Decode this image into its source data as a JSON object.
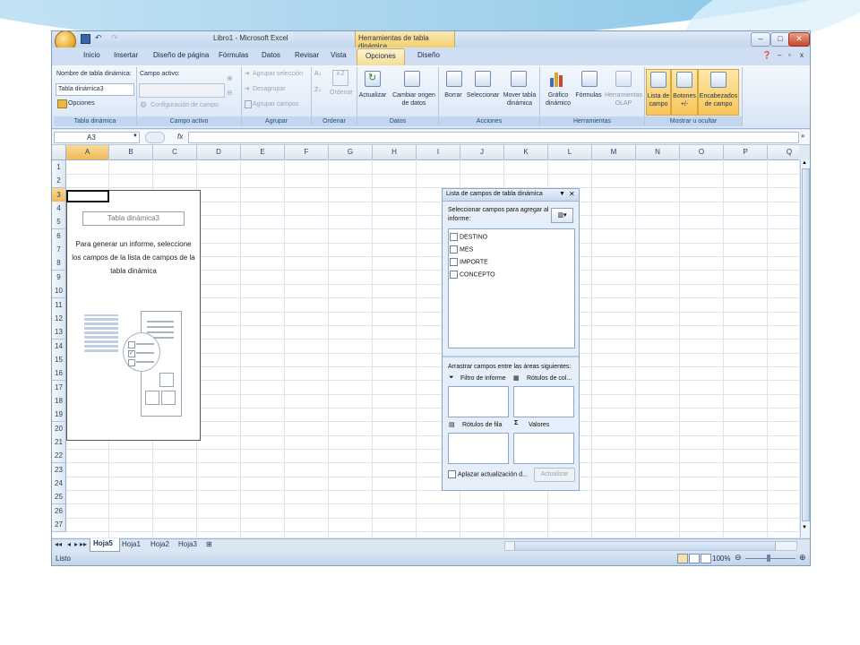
{
  "window": {
    "title": "Libro1 - Microsoft Excel",
    "context_tab": "Herramientas de tabla dinámica",
    "controls": [
      "–",
      "□",
      "✕"
    ]
  },
  "tabs": [
    "Inicio",
    "Insertar",
    "Diseño de página",
    "Fórmulas",
    "Datos",
    "Revisar",
    "Vista",
    "Opciones",
    "Diseño"
  ],
  "active_tab": "Opciones",
  "ribbon": {
    "tabla_dinamica": {
      "name_label": "Nombre de tabla dinámica:",
      "name_value": "Tabla dinámica3",
      "opciones": "Opciones",
      "group": "Tabla dinámica"
    },
    "campo_activo": {
      "label": "Campo activo:",
      "config": "Configuración de campo",
      "group": "Campo activo"
    },
    "agrupar": {
      "items": [
        "Agrupar selección",
        "Desagrupar",
        "Agrupar campos"
      ],
      "group": "Agrupar"
    },
    "ordenar": {
      "label": "Ordenar",
      "group": "Ordenar"
    },
    "datos": {
      "actualizar": "Actualizar",
      "cambiar_origen": "Cambiar origen",
      "cambiar_origen_2": "de datos",
      "group": "Datos"
    },
    "acciones": {
      "borrar": "Borrar",
      "seleccionar": "Seleccionar",
      "mover": "Mover tabla",
      "mover_2": "dinámica",
      "group": "Acciones"
    },
    "herramientas": {
      "grafico": "Gráfico",
      "grafico_2": "dinámico",
      "formulas": "Fórmulas",
      "olap": "Herramientas",
      "olap_2": "OLAP",
      "group": "Herramientas"
    },
    "mostrar": {
      "lista": "Lista de",
      "lista_2": "campo",
      "botones": "Botones",
      "botones_2": "+/-",
      "encabezados": "Encabezados",
      "encabezados_2": "de campo",
      "group": "Mostrar u ocultar"
    }
  },
  "formula_bar": {
    "name_box": "A3",
    "fx": "fx"
  },
  "grid": {
    "columns": [
      "A",
      "B",
      "C",
      "D",
      "E",
      "F",
      "G",
      "H",
      "I",
      "J",
      "K",
      "L",
      "M",
      "N",
      "O",
      "P",
      "Q"
    ],
    "rows": [
      "1",
      "2",
      "3",
      "4",
      "5",
      "6",
      "7",
      "8",
      "9",
      "10",
      "11",
      "12",
      "13",
      "14",
      "15",
      "16",
      "17",
      "18",
      "19",
      "20",
      "21",
      "22",
      "23",
      "24",
      "25",
      "26",
      "27"
    ],
    "selected_cell": "A3"
  },
  "pivot_placeholder": {
    "title": "Tabla dinámica3",
    "line1": "Para generar un informe, seleccione",
    "line2": "los campos de la lista de campos de la",
    "line3": "tabla dinámica"
  },
  "field_list": {
    "title": "Lista de campos de tabla dinámica",
    "instruction_1": "Seleccionar campos para agregar al",
    "instruction_2": "informe:",
    "fields": [
      "DESTINO",
      "MES",
      "IMPORTE",
      "CONCEPTO"
    ],
    "areas_label": "Arrastrar campos entre las áreas siguientes:",
    "filtro": "Filtro de informe",
    "columnas": "Rótulos de col...",
    "filas": "Rótulos de fila",
    "valores": "Valores",
    "defer": "Aplazar actualización d...",
    "update_button": "Actualizar"
  },
  "sheets": [
    "Hoja5",
    "Hoja1",
    "Hoja2",
    "Hoja3"
  ],
  "active_sheet": "Hoja5",
  "status": {
    "text": "Listo",
    "zoom": "100%"
  }
}
